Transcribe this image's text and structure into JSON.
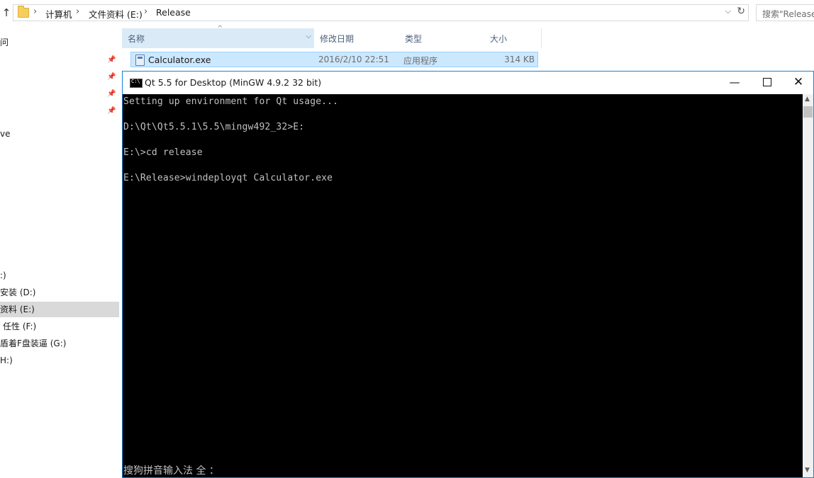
{
  "explorer": {
    "breadcrumb": [
      "计算机",
      "文件资料 (E:)",
      "Release"
    ],
    "search_placeholder": "搜索\"Release\"",
    "nav_items": [
      {
        "label": "问",
        "selected": false
      },
      {
        "label": "ve",
        "selected": false
      },
      {
        "label": ":)",
        "selected": false
      },
      {
        "label": "安装 (D:)",
        "selected": false
      },
      {
        "label": "资料 (E:)",
        "selected": true
      },
      {
        "label": "任性 (F:)",
        "selected": false
      },
      {
        "label": "盾着F盘装逼 (G:)",
        "selected": false
      },
      {
        "label": "H:)",
        "selected": false
      }
    ],
    "columns": {
      "name": "名称",
      "date": "修改日期",
      "type": "类型",
      "size": "大小"
    },
    "files": [
      {
        "name": "Calculator.exe",
        "date": "2016/2/10 22:51",
        "type": "应用程序",
        "size": "314 KB",
        "selected": true
      }
    ]
  },
  "console": {
    "title": "Qt 5.5 for Desktop (MinGW 4.9.2 32 bit)",
    "lines": [
      "Setting up environment for Qt usage...",
      "",
      "D:\\Qt\\Qt5.5.1\\5.5\\mingw492_32>E:",
      "",
      "E:\\>cd release",
      "",
      "E:\\Release>windeployqt Calculator.exe"
    ],
    "ime_status": "搜狗拼音输入法 全 ：",
    "colors": {
      "background": "#000000",
      "text": "#c0c0c0",
      "border": "#1883d7"
    }
  },
  "icons": {
    "up": "up-arrow-icon",
    "folder": "folder-icon",
    "refresh": "refresh-icon",
    "pin": "pin-icon",
    "app": "exe-file-icon",
    "console": "console-icon"
  }
}
